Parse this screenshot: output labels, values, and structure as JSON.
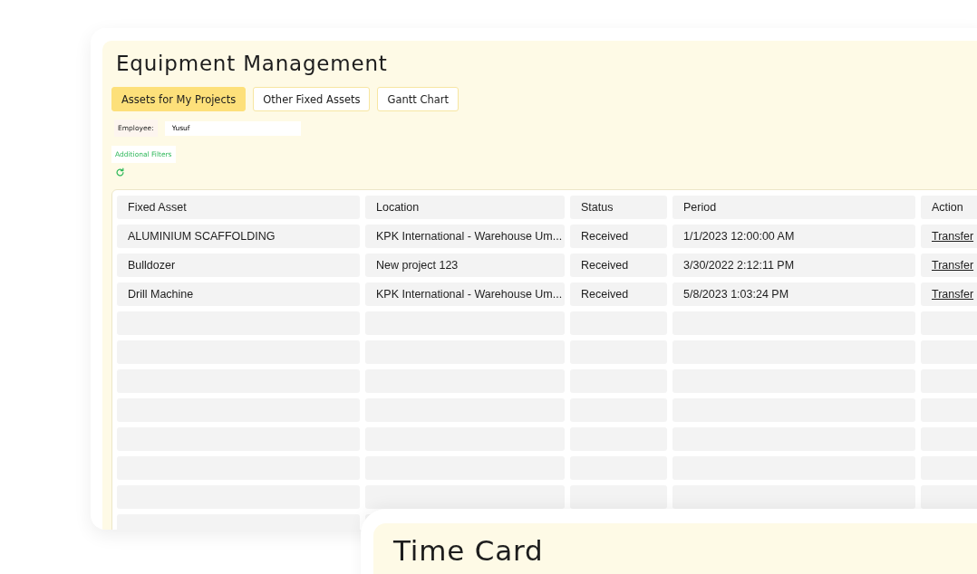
{
  "title": "Equipment Management",
  "tabs": [
    {
      "label": "Assets for My Projects",
      "selected": true
    },
    {
      "label": "Other Fixed Assets",
      "selected": false
    },
    {
      "label": "Gantt Chart",
      "selected": false
    }
  ],
  "employee": {
    "label": "Employee:",
    "value": "Yusuf"
  },
  "additional_filters": "Additional Filters",
  "table": {
    "columns": [
      "Fixed Asset",
      "Location",
      "Status",
      "Period",
      "Action"
    ],
    "rows": [
      {
        "fixed_asset": "ALUMINIUM SCAFFOLDING",
        "location": "KPK International - Warehouse Um...",
        "status": "Received",
        "period": "1/1/2023 12:00:00 AM",
        "action": "Transfer"
      },
      {
        "fixed_asset": "Bulldozer",
        "location": "New project 123",
        "status": "Received",
        "period": "3/30/2022 2:12:11 PM",
        "action": "Transfer"
      },
      {
        "fixed_asset": "Drill Machine",
        "location": "KPK International - Warehouse Um...",
        "status": "Received",
        "period": "5/8/2023 1:03:24 PM",
        "action": "Transfer"
      }
    ]
  },
  "second_card": {
    "title": "Time Card"
  }
}
